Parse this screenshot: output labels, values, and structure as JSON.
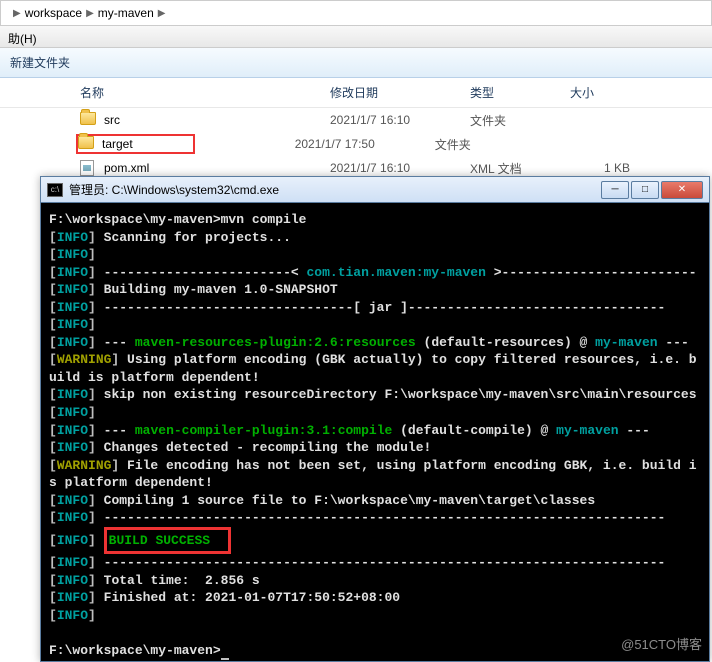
{
  "breadcrumb": {
    "item1": "workspace",
    "item2": "my-maven"
  },
  "menubar": {
    "item1": "助(H)"
  },
  "toolbar": {
    "new_folder": "新建文件夹"
  },
  "columns": {
    "name": "名称",
    "date": "修改日期",
    "type": "类型",
    "size": "大小"
  },
  "files": [
    {
      "name": "src",
      "date": "2021/1/7 16:10",
      "type": "文件夹",
      "size": ""
    },
    {
      "name": "target",
      "date": "2021/1/7 17:50",
      "type": "文件夹",
      "size": ""
    },
    {
      "name": "pom.xml",
      "date": "2021/1/7 16:10",
      "type": "XML 文档",
      "size": "1 KB"
    }
  ],
  "terminal": {
    "title": "管理员: C:\\Windows\\system32\\cmd.exe",
    "prompt1": "F:\\workspace\\my-maven>mvn compile",
    "l_info": "INFO",
    "l_warn": "WARNING",
    "scanning": "Scanning for projects...",
    "group_sep1": "------------------------< ",
    "group_id": "com.tian.maven:my-maven",
    "group_sep2": " >-------------------------",
    "building": "Building my-maven 1.0-SNAPSHOT",
    "jar_sep1": "--------------------------------[ jar ]---------------------------------",
    "plugin1_sep": "--- ",
    "plugin1": "maven-resources-plugin:2.6:resources",
    "plugin1_rest": " (default-resources) @ ",
    "proj": "my-maven",
    "plugin1_end": " ---",
    "warn1": "Using platform encoding (GBK actually) to copy filtered resources, i.e. build is platform dependent!",
    "skip_res": "skip non existing resourceDirectory F:\\workspace\\my-maven\\src\\main\\resources",
    "plugin2": "maven-compiler-plugin:3.1:compile",
    "plugin2_rest": " (default-compile) @ ",
    "changes": "Changes detected - recompiling the module!",
    "warn2": "File encoding has not been set, using platform encoding GBK, i.e. build is platform dependent!",
    "compiling": "Compiling 1 source file to F:\\workspace\\my-maven\\target\\classes",
    "hr": "------------------------------------------------------------------------",
    "success": "BUILD SUCCESS",
    "total_time": "Total time:  2.856 s",
    "finished": "Finished at: 2021-01-07T17:50:52+08:00",
    "prompt2": "F:\\workspace\\my-maven>"
  },
  "watermark": "@51CTO博客"
}
